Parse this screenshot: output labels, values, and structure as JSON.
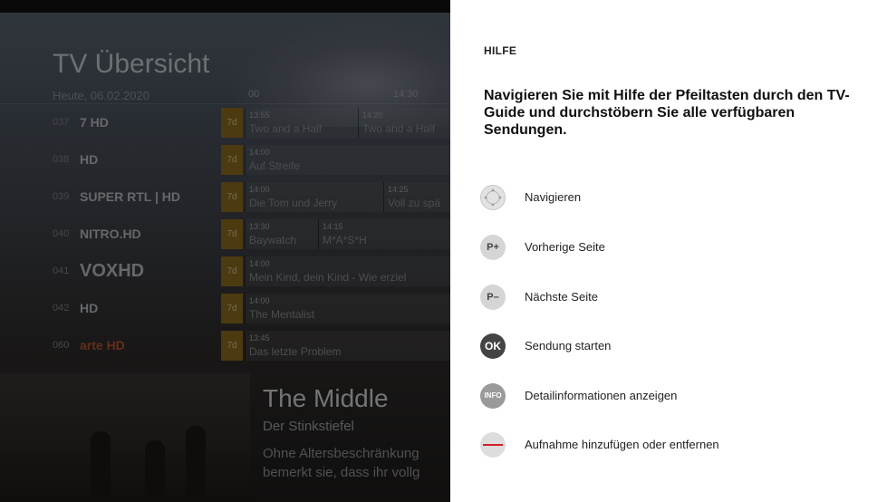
{
  "guide": {
    "title": "TV Übersicht",
    "date": "Heute, 06.02.2020",
    "time_a": "00",
    "time_b": "14:30",
    "catchup_label": "7d",
    "channels": [
      {
        "num": "037",
        "logo": "7 HD",
        "programs": [
          {
            "time": "13:55",
            "name": "Two and a Half"
          },
          {
            "time": "14:20",
            "name": "Two and a Half"
          }
        ]
      },
      {
        "num": "038",
        "logo": "HD",
        "programs": [
          {
            "time": "14:00",
            "name": "Auf Streife"
          }
        ]
      },
      {
        "num": "039",
        "logo": "SUPER RTL | HD",
        "programs": [
          {
            "time": "14:00",
            "name": "Die Tom und Jerry"
          },
          {
            "time": "14:25",
            "name": "Voll zu spä"
          }
        ]
      },
      {
        "num": "040",
        "logo": "NITRO.HD",
        "programs": [
          {
            "time": "13:30",
            "name": "Baywatch"
          },
          {
            "time": "14:15",
            "name": "M*A*S*H"
          }
        ]
      },
      {
        "num": "041",
        "logo": "VOXHD",
        "programs": [
          {
            "time": "14:00",
            "name": "Mein Kind, dein Kind - Wie erziel"
          }
        ]
      },
      {
        "num": "042",
        "logo": "HD",
        "programs": [
          {
            "time": "14:00",
            "name": "The Mentalist"
          }
        ]
      },
      {
        "num": "060",
        "logo": "arte HD",
        "programs": [
          {
            "time": "13:45",
            "name": "Das letzte Problem"
          }
        ]
      }
    ]
  },
  "preview": {
    "title": "The Middle",
    "subtitle": "Der Stinkstiefel",
    "desc_line1": "Ohne Altersbeschränkung",
    "desc_line2": "bemerkt sie, dass ihr vollg"
  },
  "help": {
    "heading": "HILFE",
    "text": "Navigieren Sie mit Hilfe der Pfeiltasten durch den TV-Guide und durchstöbern Sie alle verfügbaren Sendungen.",
    "items": [
      {
        "icon": "nav-pad-icon",
        "key": "",
        "label": "Navigieren"
      },
      {
        "icon": "page-up-icon",
        "key": "P+",
        "label": "Vorherige Seite"
      },
      {
        "icon": "page-down-icon",
        "key": "P–",
        "label": "Nächste Seite"
      },
      {
        "icon": "ok-icon",
        "key": "OK",
        "label": "Sendung starten"
      },
      {
        "icon": "info-icon",
        "key": "INFO",
        "label": "Detailinformationen anzeigen"
      },
      {
        "icon": "record-icon",
        "key": "",
        "label": "Aufnahme hinzufügen oder entfernen"
      }
    ]
  },
  "colors": {
    "panel": "#ffffff",
    "catchup": "#8a6a1f",
    "record": "#d0202a"
  }
}
